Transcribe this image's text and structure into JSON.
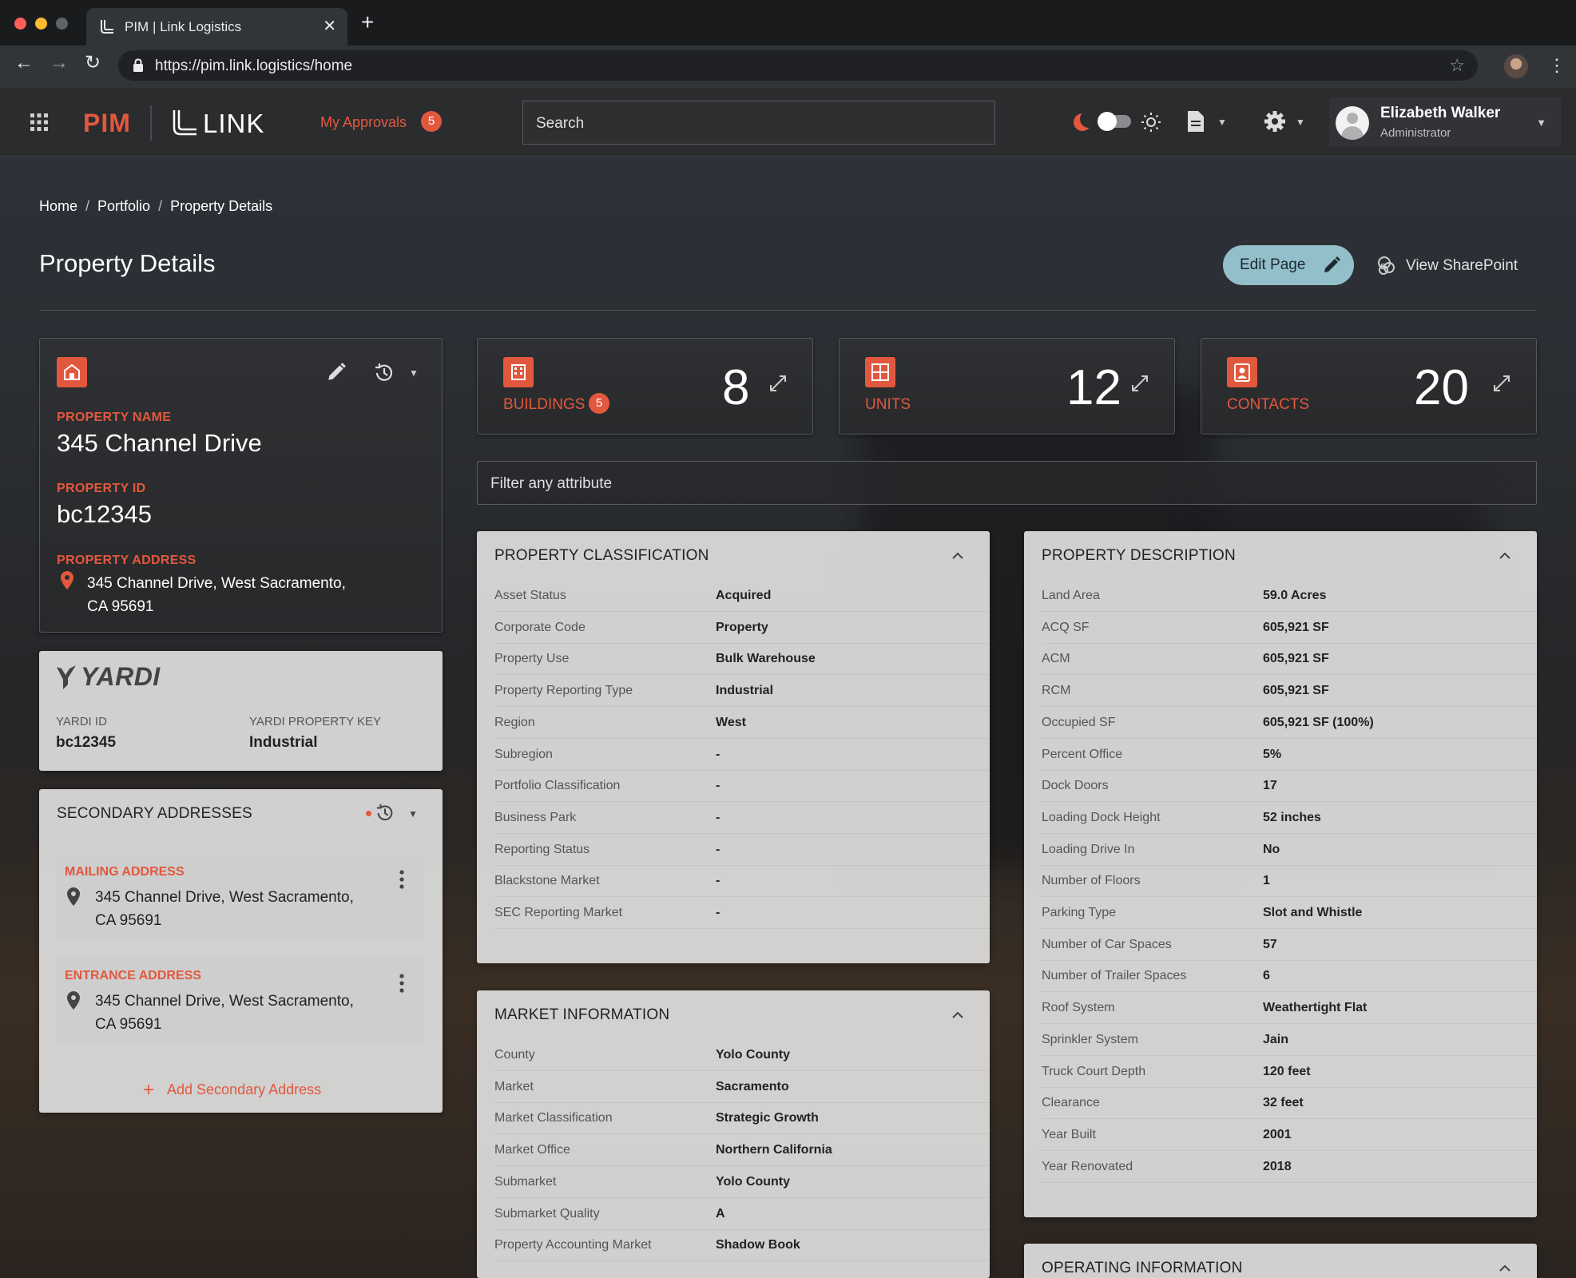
{
  "browser": {
    "tab_title": "PIM | Link Logistics",
    "url": "https://pim.link.logistics/home"
  },
  "app": {
    "brand_pim": "PIM",
    "brand_link": "LINK",
    "approvals_label": "My Approvals",
    "approvals_count": "5",
    "search_placeholder": "Search",
    "user_name": "Elizabeth Walker",
    "user_role": "Administrator"
  },
  "page": {
    "breadcrumb": [
      "Home",
      "Portfolio",
      "Property Details"
    ],
    "title": "Property Details",
    "edit_button": "Edit Page",
    "sharepoint_link": "View SharePoint"
  },
  "property": {
    "name_label": "PROPERTY NAME",
    "name": "345 Channel Drive",
    "id_label": "PROPERTY ID",
    "id": "bc12345",
    "address_label": "PROPERTY ADDRESS",
    "address_line1": "345 Channel Drive, West Sacramento,",
    "address_line2": "CA 95691"
  },
  "metrics": {
    "buildings": {
      "label": "BUILDINGS",
      "badge": "5",
      "value": "8"
    },
    "units": {
      "label": "UNITS",
      "value": "12"
    },
    "contacts": {
      "label": "CONTACTS",
      "value": "20"
    }
  },
  "filter_placeholder": "Filter any attribute",
  "yardi": {
    "logo_text": "YARDI",
    "id_label": "YARDI ID",
    "id_value": "bc12345",
    "key_label": "YARDI PROPERTY KEY",
    "key_value": "Industrial"
  },
  "secondary": {
    "title": "SECONDARY ADDRESSES",
    "addresses": [
      {
        "label": "MAILING ADDRESS",
        "line1": "345 Channel Drive, West Sacramento,",
        "line2": "CA 95691"
      },
      {
        "label": "ENTRANCE ADDRESS",
        "line1": "345 Channel Drive, West Sacramento,",
        "line2": "CA 95691"
      }
    ],
    "add_label": "Add Secondary Address"
  },
  "classification": {
    "title": "PROPERTY CLASSIFICATION",
    "rows": [
      {
        "label": "Asset Status",
        "value": "Acquired"
      },
      {
        "label": "Corporate Code",
        "value": "Property"
      },
      {
        "label": "Property Use",
        "value": "Bulk Warehouse"
      },
      {
        "label": "Property Reporting Type",
        "value": "Industrial"
      },
      {
        "label": "Region",
        "value": "West"
      },
      {
        "label": "Subregion",
        "value": "-"
      },
      {
        "label": "Portfolio Classification",
        "value": "-"
      },
      {
        "label": "Business Park",
        "value": "-"
      },
      {
        "label": "Reporting Status",
        "value": "-"
      },
      {
        "label": "Blackstone Market",
        "value": "-"
      },
      {
        "label": "SEC Reporting Market",
        "value": "-"
      }
    ]
  },
  "market": {
    "title": "MARKET INFORMATION",
    "rows": [
      {
        "label": "County",
        "value": "Yolo County"
      },
      {
        "label": "Market",
        "value": "Sacramento"
      },
      {
        "label": "Market Classification",
        "value": "Strategic Growth"
      },
      {
        "label": "Market Office",
        "value": "Northern California"
      },
      {
        "label": "Submarket",
        "value": "Yolo County"
      },
      {
        "label": "Submarket Quality",
        "value": "A"
      },
      {
        "label": "Property Accounting Market",
        "value": "Shadow Book"
      }
    ]
  },
  "description": {
    "title": "PROPERTY DESCRIPTION",
    "rows": [
      {
        "label": "Land Area",
        "value": "59.0 Acres"
      },
      {
        "label": "ACQ SF",
        "value": "605,921 SF"
      },
      {
        "label": "ACM",
        "value": "605,921 SF"
      },
      {
        "label": "RCM",
        "value": "605,921 SF"
      },
      {
        "label": "Occupied SF",
        "value": "605,921 SF (100%)"
      },
      {
        "label": "Percent Office",
        "value": "5%"
      },
      {
        "label": "Dock Doors",
        "value": "17"
      },
      {
        "label": "Loading Dock Height",
        "value": "52 inches"
      },
      {
        "label": "Loading Drive In",
        "value": "No"
      },
      {
        "label": "Number of Floors",
        "value": "1"
      },
      {
        "label": "Parking Type",
        "value": "Slot and Whistle"
      },
      {
        "label": "Number of Car Spaces",
        "value": "57"
      },
      {
        "label": "Number of Trailer Spaces",
        "value": "6"
      },
      {
        "label": "Roof System",
        "value": "Weathertight Flat"
      },
      {
        "label": "Sprinkler System",
        "value": "Jain"
      },
      {
        "label": "Truck Court Depth",
        "value": "120 feet"
      },
      {
        "label": "Clearance",
        "value": "32 feet"
      },
      {
        "label": "Year Built",
        "value": "2001"
      },
      {
        "label": "Year Renovated",
        "value": "2018"
      }
    ]
  },
  "operating": {
    "title": "OPERATING INFORMATION"
  },
  "colors": {
    "accent": "#e2583e",
    "edit_button": "#92bfc9"
  }
}
